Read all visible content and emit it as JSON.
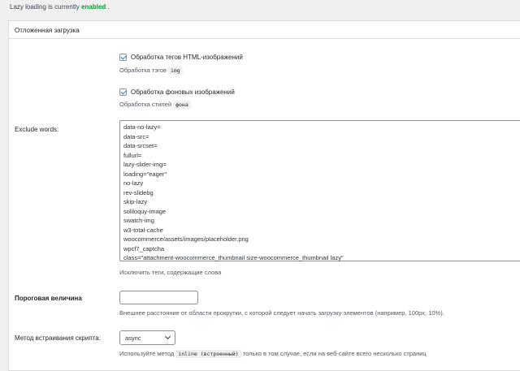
{
  "notice": {
    "prefix": "Lazy loading is currently ",
    "status": "enabled",
    "suffix": " ."
  },
  "panel": {
    "title": "Отложенная загрузка"
  },
  "options": {
    "html_images": {
      "label": "Обработка тегов HTML-изображений",
      "checked": true,
      "desc_prefix": "Обработка тэгов ",
      "desc_code": "img"
    },
    "bg_images": {
      "label": "Обработка фоновых изображений",
      "checked": true,
      "desc_prefix": "Обработка стилей ",
      "desc_code": "фона"
    }
  },
  "exclude": {
    "label": "Exclude words:",
    "lines": [
      "data-no-lazy=",
      "data-src=",
      "data-srcset=",
      "fullurl=",
      "lazy-slider-img=",
      "loading=\"eager\"",
      "no-lazy",
      "rev-slidebg",
      "skip-lazy",
      "soliloquy-image",
      "swatch-img",
      "w3-total-cache",
      "woocommerce/assets/images/placeholder.png",
      "wpcf7_captcha",
      "class=\"attachment-woocommerce_thumbnail size-woocommerce_thumbnail lazy\""
    ],
    "desc": "Исключить теги, содержащие слова"
  },
  "threshold": {
    "label": "Пороговая величина",
    "value": "",
    "desc": "Внешнее расстояние от области прокрутки, с которой следует начать загрузку элементов (например, 100px, 10%)."
  },
  "embed": {
    "label": "Метод встраивания скрипта:",
    "selected": "async",
    "desc_prefix": "Используйте метод ",
    "desc_code": "inline (встроенный)",
    "desc_suffix": " только в том случае, если на веб-сайте всего несколько страниц"
  }
}
